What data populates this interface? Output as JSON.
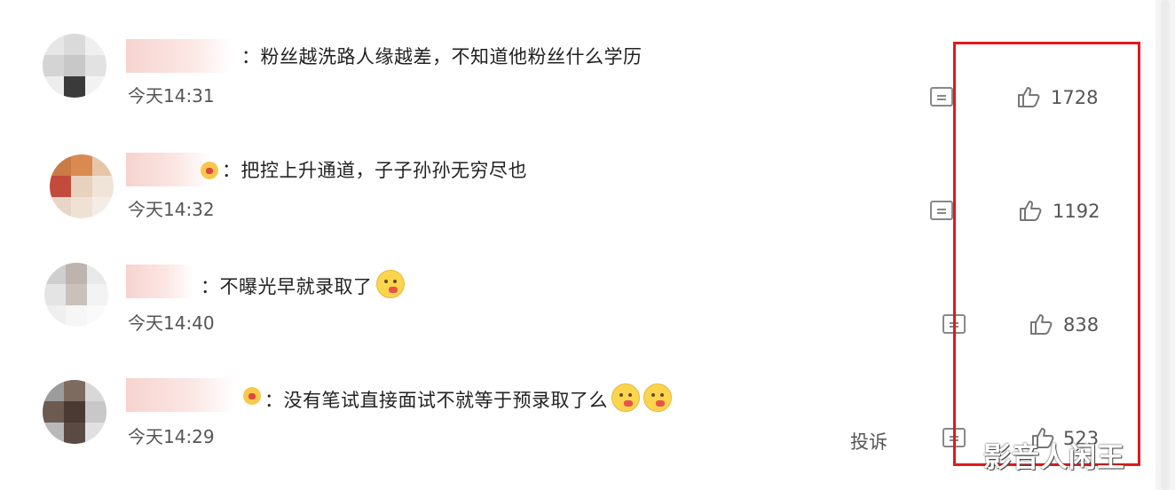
{
  "comments": [
    {
      "text": "：粉丝越洗路人缘越差，不知道他粉丝什么学历",
      "time": "今天14:31",
      "likes": "1728"
    },
    {
      "text": "：把控上升通道，子子孙孙无穷尽也",
      "time": "今天14:32",
      "likes": "1192"
    },
    {
      "text": "：不曝光早就录取了",
      "time": "今天14:40",
      "likes": "838"
    },
    {
      "text": "：没有笔试直接面试不就等于预录取了么",
      "time": "今天14:29",
      "likes": "523"
    }
  ],
  "actions": {
    "report_label": "投诉"
  },
  "watermark": "影音人闲王",
  "icons": [
    "reply-icon",
    "thumbs-up-icon",
    "emoji-icon",
    "badge-icon"
  ],
  "colors": {
    "highlight_box": "#e01a1a",
    "text": "#222222",
    "meta": "#555555"
  }
}
